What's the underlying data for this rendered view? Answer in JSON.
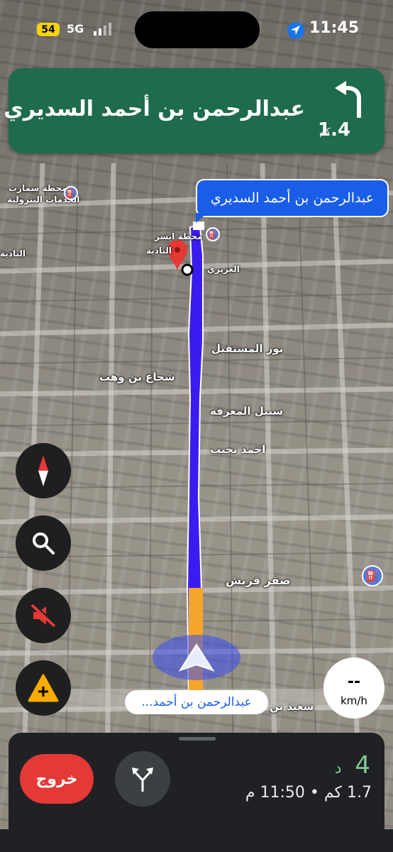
{
  "status_bar": {
    "battery": "54",
    "network": "5G",
    "time": "11:45"
  },
  "banner": {
    "street": "عبدالرحمن بن أحمد السديري",
    "distance_value": "1.4",
    "distance_unit": "كم",
    "maneuver_icon": "turn-left-arrow-icon",
    "background_color": "#1f6b4d"
  },
  "route_callout": {
    "text": "عبدالرحمن بن أحمد السديري"
  },
  "map": {
    "street_labels": [
      "نور المستقبل",
      "شجاع بن وهب",
      "سبيل المعرفه",
      "احمد نجيب",
      "صقر قريش",
      "سعيد بن",
      "العزيزي",
      "البادية",
      "محطة ابسر",
      "محطة سمارت",
      "الخدمات البترولية",
      "البادية"
    ],
    "route_color": "#3b1cf0",
    "traffic_color": "#f4a62a"
  },
  "controls": {
    "compass_icon": "compass-icon",
    "search_icon": "search-icon",
    "mute_icon": "volume-muted-icon",
    "report_icon": "report-incident-icon"
  },
  "speed": {
    "value": "--",
    "unit": "km/h"
  },
  "current_road": {
    "text": "عبدالرحمن بن أحمد..."
  },
  "trip": {
    "exit_label": "خروج",
    "alternate_routes_icon": "alt-routes-icon",
    "duration_value": "4",
    "duration_unit": "د",
    "summary": "1.7 كم • 11:50 م",
    "duration_color": "#81c995"
  }
}
